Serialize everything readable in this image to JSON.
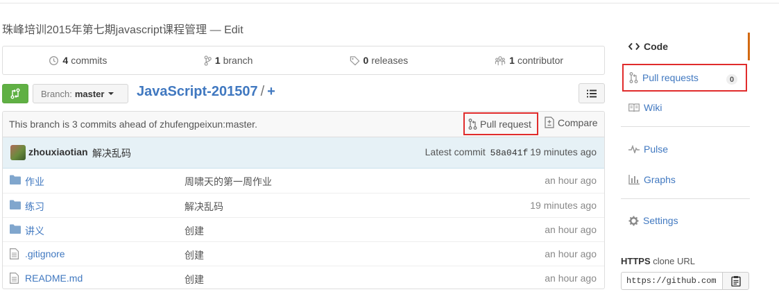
{
  "repo": {
    "description": "珠峰培训2015年第七期javascript课程管理",
    "edit_sep": " — ",
    "edit_label": "Edit",
    "name": "JavaScript-201507",
    "path_sep": "/",
    "add_glyph": "+"
  },
  "stats": {
    "commits_count": "4",
    "commits_label": "commits",
    "branch_count": "1",
    "branch_label": "branch",
    "releases_count": "0",
    "releases_label": "releases",
    "contributor_count": "1",
    "contributor_label": "contributor"
  },
  "branch": {
    "prefix": "Branch:",
    "name": "master"
  },
  "ahead_bar": {
    "text": "This branch is 3 commits ahead of zhufengpeixun:master.",
    "pull_request_label": "Pull request",
    "compare_label": "Compare"
  },
  "latest_commit": {
    "author": "zhouxiaotian",
    "message": "解决乱码",
    "prefix": "Latest commit",
    "sha": "58a041f",
    "age": "19 minutes ago"
  },
  "files": [
    {
      "type": "folder",
      "name": "作业",
      "message": "周啸天的第一周作业",
      "age": "an hour ago"
    },
    {
      "type": "folder",
      "name": "练习",
      "message": "解决乱码",
      "age": "19 minutes ago"
    },
    {
      "type": "folder",
      "name": "讲义",
      "message": "创建",
      "age": "an hour ago"
    },
    {
      "type": "file",
      "name": ".gitignore",
      "message": "创建",
      "age": "an hour ago"
    },
    {
      "type": "file",
      "name": "README.md",
      "message": "创建",
      "age": "an hour ago"
    }
  ],
  "sidebar": {
    "items": [
      {
        "label": "Code",
        "icon": "code-icon"
      },
      {
        "label": "Pull requests",
        "icon": "pull-request-icon",
        "counter": "0"
      },
      {
        "label": "Wiki",
        "icon": "book-icon"
      },
      {
        "label": "Pulse",
        "icon": "pulse-icon"
      },
      {
        "label": "Graphs",
        "icon": "graph-icon"
      },
      {
        "label": "Settings",
        "icon": "gear-icon"
      }
    ]
  },
  "clone": {
    "protocol": "HTTPS",
    "label": "clone URL",
    "url_value": "https://github.com"
  },
  "colors": {
    "link": "#4078c0",
    "compare_button": "#60b044",
    "highlight_box": "#e02b2b",
    "selected_nav_border": "#d26911",
    "commit_bar": "#e6f1f6"
  }
}
